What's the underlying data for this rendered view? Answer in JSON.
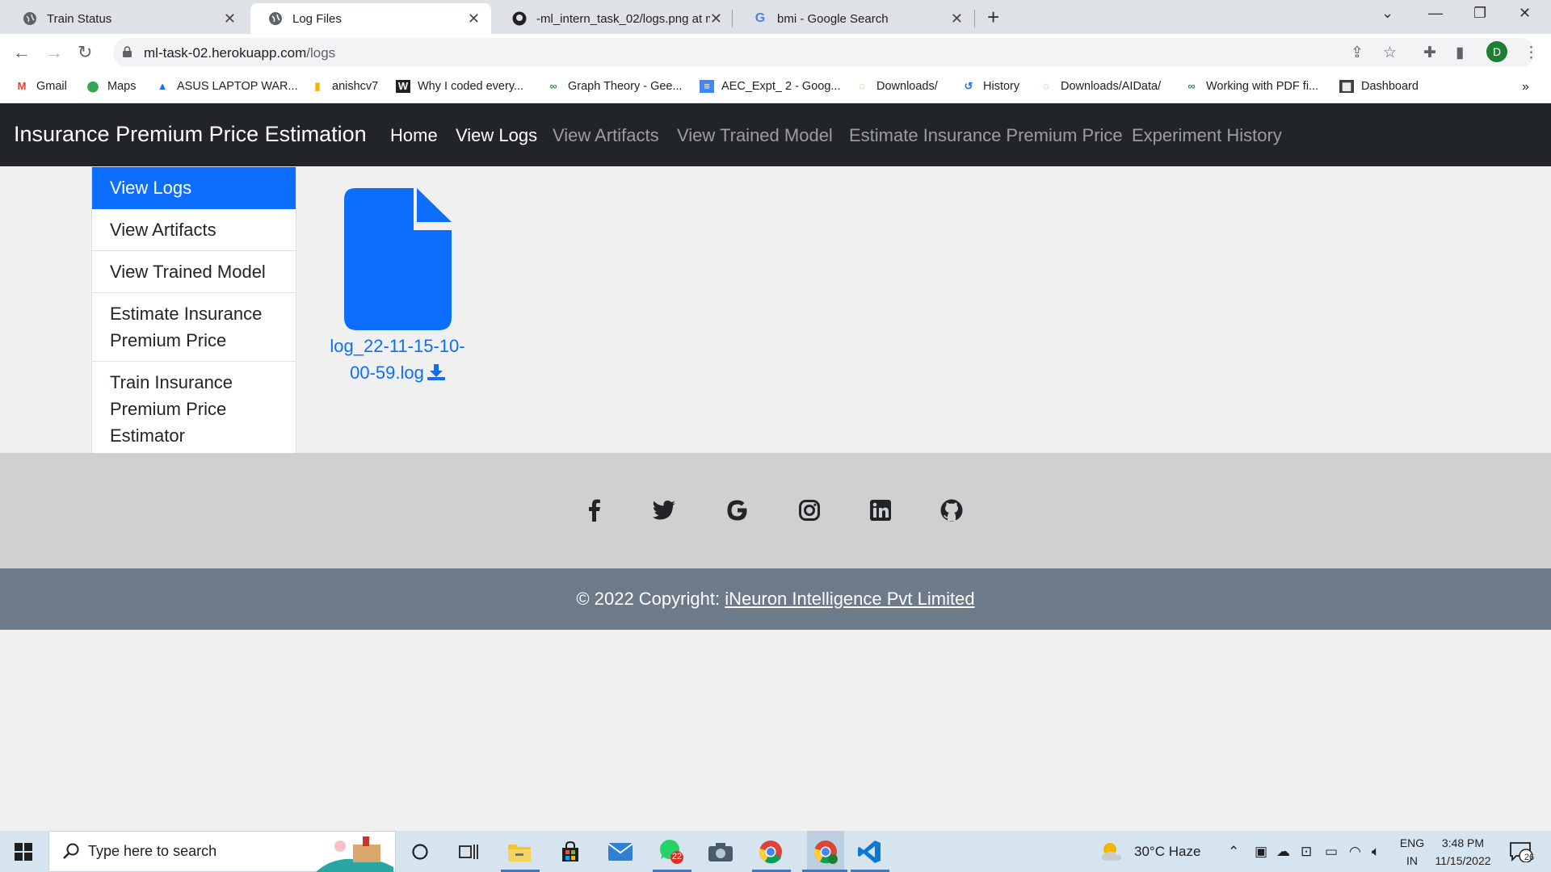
{
  "browser": {
    "tabs": [
      {
        "title": "Train Status",
        "active": false
      },
      {
        "title": "Log Files",
        "active": true
      },
      {
        "title": "-ml_intern_task_02/logs.png at m",
        "active": false
      },
      {
        "title": "bmi - Google Search",
        "active": false
      }
    ],
    "url_host": "ml-task-02.herokuapp.com",
    "url_path": "/logs",
    "profile_initial": "D",
    "bookmarks": [
      "Gmail",
      "Maps",
      "ASUS LAPTOP WAR...",
      "anishcv7",
      "Why I coded every...",
      "Graph Theory - Gee...",
      "AEC_Expt_ 2 - Goog...",
      "Downloads/",
      "History",
      "Downloads/AIData/",
      "Working with PDF fi...",
      "Dashboard"
    ],
    "more_bookmarks": "»"
  },
  "navbar": {
    "brand": "Insurance Premium Price Estimation",
    "links": [
      "Home",
      "View Logs",
      "View Artifacts",
      "View Trained Model",
      "Estimate Insurance Premium Price",
      "Experiment History"
    ]
  },
  "sidebar": {
    "items": [
      {
        "label": "View Logs",
        "active": true
      },
      {
        "label": "View Artifacts",
        "active": false
      },
      {
        "label": "View Trained Model",
        "active": false
      },
      {
        "label": "Estimate Insurance Premium Price",
        "active": false
      },
      {
        "label": "Train Insurance Premium Price Estimator",
        "active": false
      }
    ]
  },
  "files": [
    {
      "name": "log_22-11-15-10-00-59.log"
    }
  ],
  "footer": {
    "social": [
      "facebook-icon",
      "twitter-icon",
      "google-icon",
      "instagram-icon",
      "linkedin-icon",
      "github-icon"
    ],
    "copyright_prefix": "© 2022 Copyright: ",
    "company": "iNeuron Intelligence Pvt Limited"
  },
  "taskbar": {
    "search_placeholder": "Type here to search",
    "whatsapp_badge": "22",
    "weather": "30°C  Haze",
    "lang_top": "ENG",
    "lang_bottom": "IN",
    "time": "3:48 PM",
    "date": "11/15/2022",
    "notifications": "26"
  },
  "colors": {
    "primary": "#0d6efd",
    "navbar_bg": "#212529",
    "social_bg": "#d1d0d0",
    "copyright_bg": "#6c7a89"
  }
}
